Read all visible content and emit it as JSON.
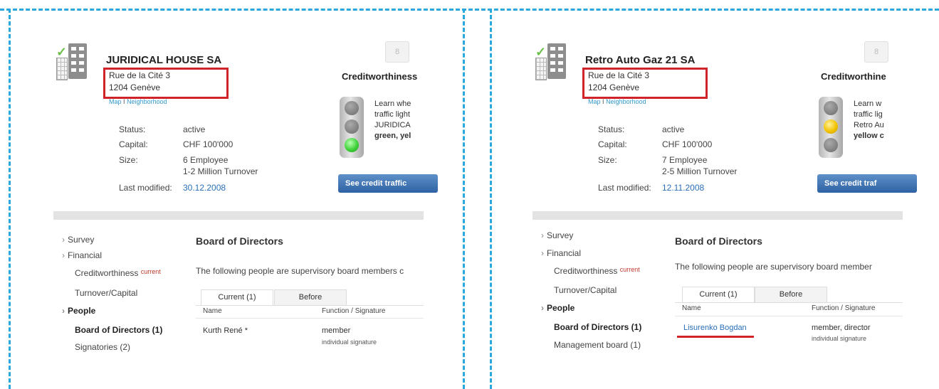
{
  "left": {
    "company_name": "JURIDICAL HOUSE SA",
    "address_line1": "Rue de la Cité 3",
    "address_line2": "1204 Genève",
    "map_link": "Map",
    "map_sep": "I",
    "neighborhood_link": "Neighborhood",
    "status_label": "Status:",
    "status_value": "active",
    "capital_label": "Capital:",
    "capital_value": "CHF 100'000",
    "size_label": "Size:",
    "size_value1": "6 Employee",
    "size_value2": "1-2 Million Turnover",
    "modified_label": "Last modified:",
    "modified_value": "30.12.2008",
    "pill_icon": "8",
    "cw_title": "Creditworthiness",
    "cw_text1": "Learn whe",
    "cw_text2": "traffic light",
    "cw_text3": "JURIDICA",
    "cw_text4": "green, yel",
    "traffic_active": "green",
    "see_button": "See credit traffic",
    "nav_survey": "Survey",
    "nav_financial": "Financial",
    "nav_creditworthiness": "Creditworthiness",
    "nav_current_tag": "current",
    "nav_turnover": "Turnover/Capital",
    "nav_people": "People",
    "nav_board": "Board of Directors (1)",
    "nav_signatories": "Signatories (2)",
    "section_title": "Board of Directors",
    "intro_text": "The following people are supervisory board members c",
    "tab_current": "Current (1)",
    "tab_before": "Before",
    "col_name": "Name",
    "col_function": "Function / Signature",
    "row_name": "Kurth René *",
    "row_function": "member",
    "row_signature": "individual signature"
  },
  "right": {
    "company_name": "Retro Auto Gaz 21 SA",
    "address_line1": "Rue de la Cité 3",
    "address_line2": "1204 Genève",
    "map_link": "Map",
    "map_sep": "I",
    "neighborhood_link": "Neighborhood",
    "status_label": "Status:",
    "status_value": "active",
    "capital_label": "Capital:",
    "capital_value": "CHF 100'000",
    "size_label": "Size:",
    "size_value1": "7 Employee",
    "size_value2": "2-5 Million Turnover",
    "modified_label": "Last modified:",
    "modified_value": "12.11.2008",
    "pill_icon": "8",
    "cw_title": "Creditworthine",
    "cw_text1": "Learn w",
    "cw_text2": "traffic lig",
    "cw_text3": "Retro Au",
    "cw_text4": "yellow c",
    "traffic_active": "yellow",
    "see_button": "See credit traf",
    "nav_survey": "Survey",
    "nav_financial": "Financial",
    "nav_creditworthiness": "Creditworthiness",
    "nav_current_tag": "current",
    "nav_turnover": "Turnover/Capital",
    "nav_people": "People",
    "nav_board": "Board of Directors (1)",
    "nav_management": "Management board (1)",
    "section_title": "Board of Directors",
    "intro_text": "The following people are supervisory board member",
    "tab_current": "Current (1)",
    "tab_before": "Before",
    "col_name": "Name",
    "col_function": "Function / Signature",
    "row_name": "Lisurenko Bogdan",
    "row_function": "member, director",
    "row_signature": "individual signature"
  },
  "colors": {
    "highlight_red": "#d0232a",
    "dash_blue": "#2aa7dc",
    "link_blue": "#2a6fb8",
    "lamp_green": "#3fd23a",
    "lamp_yellow": "#f2c200"
  }
}
